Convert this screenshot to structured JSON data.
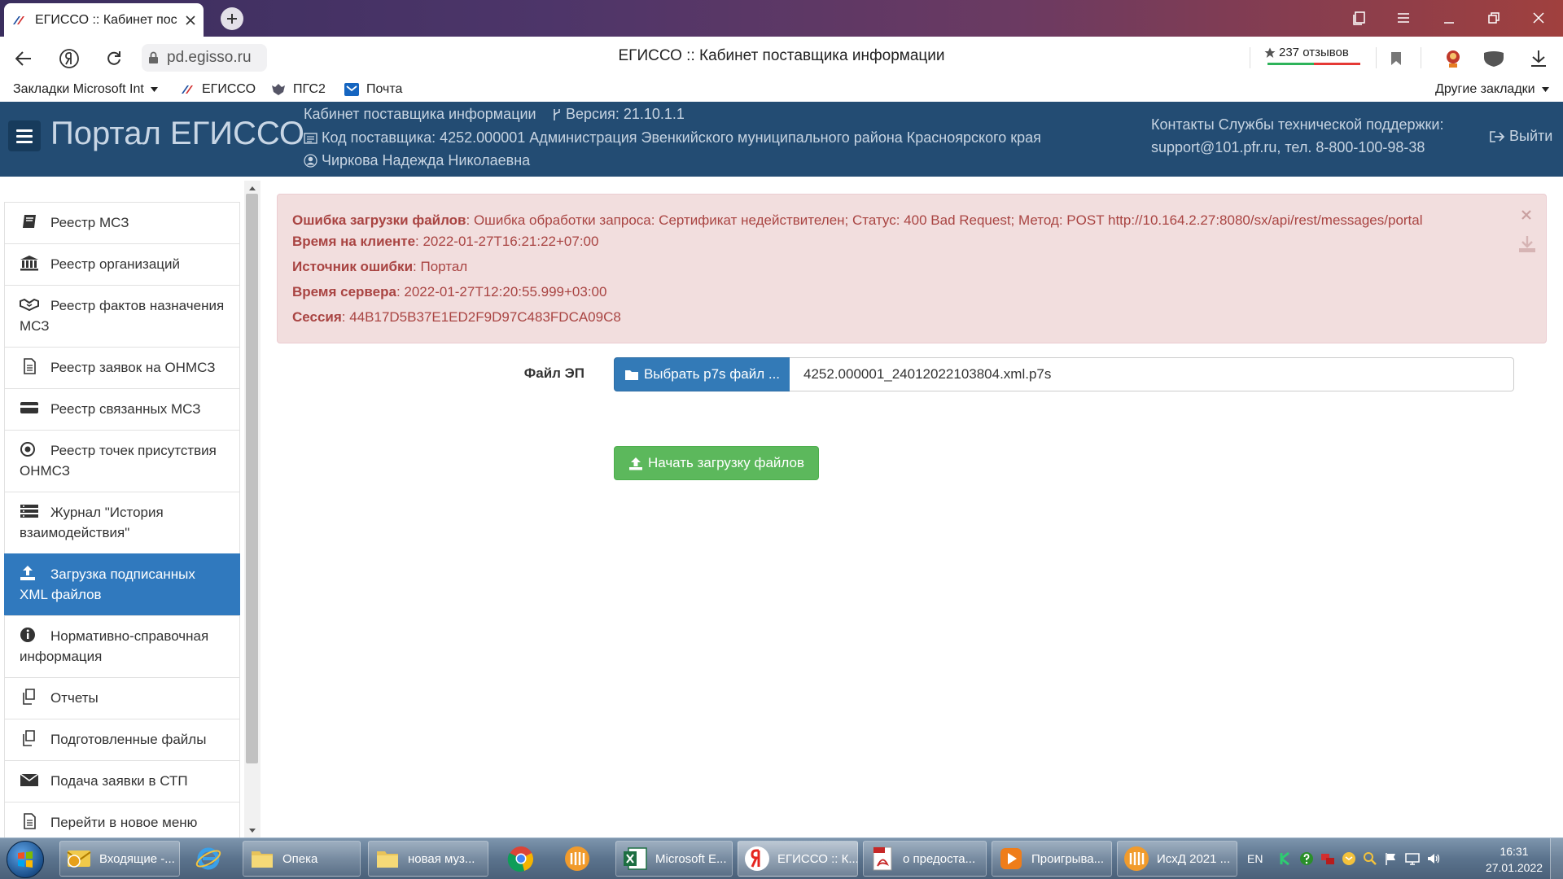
{
  "browser": {
    "tab_title": "ЕГИССО :: Кабинет пост",
    "url": "pd.egisso.ru",
    "page_title": "ЕГИССО :: Кабинет поставщика информации",
    "reviews": "237 отзывов",
    "bookmarks": [
      "Закладки Microsoft Int",
      "ЕГИССО",
      "ПГС2",
      "Почта"
    ],
    "other_bookmarks": "Другие закладки"
  },
  "header": {
    "portal_title": "Портал ЕГИССО",
    "cabinet": "Кабинет поставщика информации",
    "version": "Версия: 21.10.1.1",
    "supplier": "Код поставщика: 4252.000001 Администрация Эвенкийского муниципального района Красноярского края",
    "user": "Чиркова Надежда Николаевна",
    "support_line1": "Контакты Службы технической поддержки:",
    "support_line2": "support@101.pfr.ru, тел. 8-800-100-98-38",
    "logout": "Выйти"
  },
  "sidebar": {
    "items": [
      {
        "label": "Реестр МСЗ",
        "icon": "book-icon"
      },
      {
        "label": "Реестр организаций",
        "icon": "bank-icon"
      },
      {
        "label": "Реестр фактов назначения МСЗ",
        "icon": "handshake-icon"
      },
      {
        "label": "Реестр заявок на ОНМСЗ",
        "icon": "document-icon"
      },
      {
        "label": "Реестр связанных МСЗ",
        "icon": "card-icon"
      },
      {
        "label": "Реестр точек присутствия ОНМСЗ",
        "icon": "target-icon"
      },
      {
        "label": "Журнал \"История взаимодействия\"",
        "icon": "list-icon"
      },
      {
        "label": "Загрузка подписанных XML файлов",
        "icon": "upload-icon"
      },
      {
        "label": "Нормативно-справочная информация",
        "icon": "info-icon"
      },
      {
        "label": "Отчеты",
        "icon": "copy-icon"
      },
      {
        "label": "Подготовленные файлы",
        "icon": "copy-icon"
      },
      {
        "label": "Подача заявки в СТП",
        "icon": "envelope-icon"
      },
      {
        "label": "Перейти в новое меню",
        "icon": "document-icon"
      }
    ]
  },
  "error": {
    "l1_label": "Ошибка загрузки файлов",
    "l1_value": ": Ошибка обработки запроса: Сертификат недействителен; Статус: 400 Bad Request; Метод: POST http://10.164.2.27:8080/sx/api/rest/messages/portal",
    "l2_label": "Время на клиенте",
    "l2_value": ": 2022-01-27T16:21:22+07:00",
    "l3_label": "Источник ошибки",
    "l3_value": ": Портал",
    "l4_label": "Время сервера",
    "l4_value": ": 2022-01-27T12:20:55.999+03:00",
    "l5_label": "Сессия",
    "l5_value": ": 44B17D5B37E1ED2F9D97C483FDCA09C8"
  },
  "form": {
    "file_label": "Файл ЭП",
    "choose_button": "Выбрать p7s файл ...",
    "file_value": "4252.000001_24012022103804.xml.p7s",
    "upload_button": "Начать загрузку файлов"
  },
  "taskbar": {
    "items": [
      "Входящие -...",
      "Опека",
      "новая муз...",
      "Microsoft E...",
      "ЕГИССО :: К...",
      "о предоста...",
      "Проигрыва...",
      "ИсхД 2021 ..."
    ],
    "lang": "EN",
    "time": "16:31",
    "date": "27.01.2022"
  },
  "colors": {
    "header_bg": "#234c73",
    "active_item": "#3079be",
    "error_bg": "#f2dede",
    "error_text": "#a94442",
    "primary_btn": "#337ab7",
    "success_btn": "#5cb85c"
  }
}
